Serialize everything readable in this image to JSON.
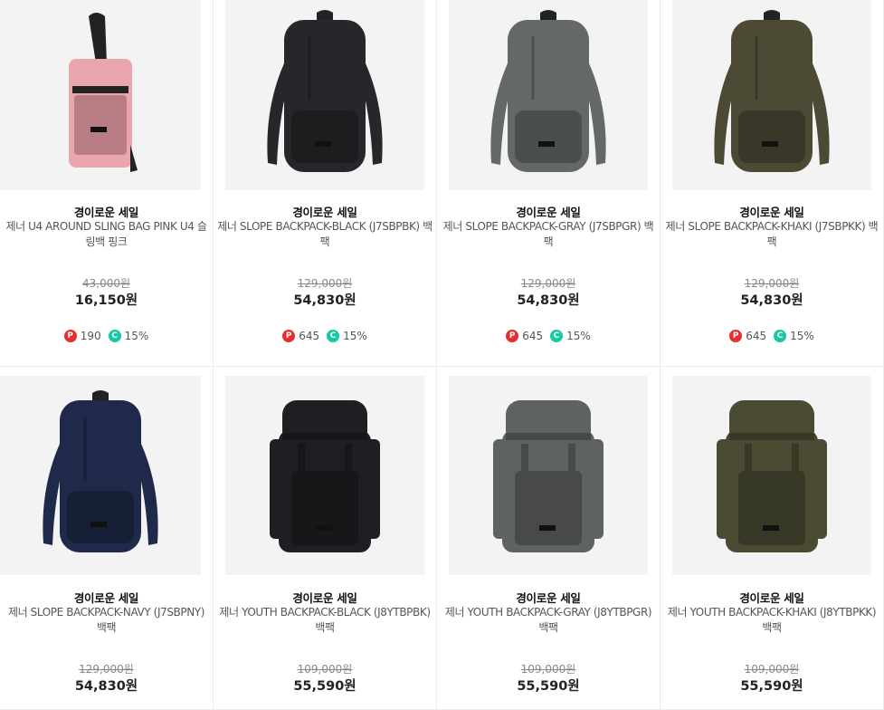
{
  "products": [
    {
      "tag": "경이로운 세일",
      "name": "제너 U4 AROUND SLING BAG PINK U4 슬링백 핑크",
      "original_price": "43,000원",
      "price": "16,150원",
      "points": "190",
      "coupon": "15%",
      "bag_color": "#eaa6ad",
      "style": "sling"
    },
    {
      "tag": "경이로운 세일",
      "name": "제너 SLOPE BACKPACK-BLACK (J7SBPBK) 백팩",
      "original_price": "129,000원",
      "price": "54,830원",
      "points": "645",
      "coupon": "15%",
      "bag_color": "#25272a",
      "style": "slope"
    },
    {
      "tag": "경이로운 세일",
      "name": "제너 SLOPE BACKPACK-GRAY (J7SBPGR) 백팩",
      "original_price": "129,000원",
      "price": "54,830원",
      "points": "645",
      "coupon": "15%",
      "bag_color": "#656868",
      "style": "slope"
    },
    {
      "tag": "경이로운 세일",
      "name": "제너 SLOPE BACKPACK-KHAKI (J7SBPKK) 백팩",
      "original_price": "129,000원",
      "price": "54,830원",
      "points": "645",
      "coupon": "15%",
      "bag_color": "#4c4a34",
      "style": "slope"
    },
    {
      "tag": "경이로운 세일",
      "name": "제너 SLOPE BACKPACK-NAVY (J7SBPNY) 백팩",
      "original_price": "129,000원",
      "price": "54,830원",
      "bag_color": "#1f2a4a",
      "style": "slope"
    },
    {
      "tag": "경이로운 세일",
      "name": "제너 YOUTH BACKPACK-BLACK (J8YTBPBK) 백팩",
      "original_price": "109,000원",
      "price": "55,590원",
      "bag_color": "#1e1f22",
      "style": "youth"
    },
    {
      "tag": "경이로운 세일",
      "name": "제너 YOUTH BACKPACK-GRAY (J8YTBPGR) 백팩",
      "original_price": "109,000원",
      "price": "55,590원",
      "bag_color": "#5f6263",
      "style": "youth"
    },
    {
      "tag": "경이로운 세일",
      "name": "제너 YOUTH BACKPACK-KHAKI (J8YTBPKK) 백팩",
      "original_price": "109,000원",
      "price": "55,590원",
      "bag_color": "#4b4b33",
      "style": "youth"
    }
  ],
  "icons": {
    "points": "P",
    "coupon": "C"
  },
  "colors": {
    "points_badge": "#e62e2e",
    "coupon_badge": "#17c9a2"
  }
}
